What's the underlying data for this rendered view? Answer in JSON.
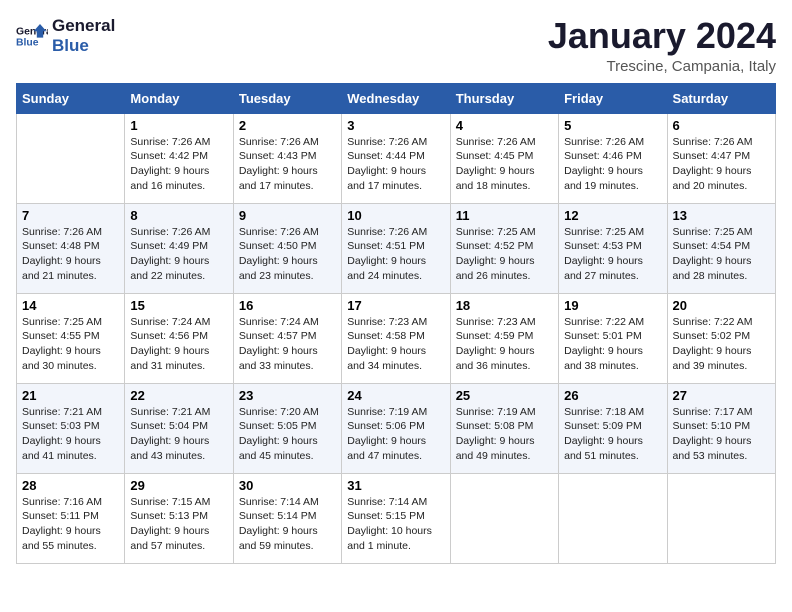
{
  "header": {
    "logo_text_general": "General",
    "logo_text_blue": "Blue",
    "month_title": "January 2024",
    "location": "Trescine, Campania, Italy"
  },
  "days_of_week": [
    "Sunday",
    "Monday",
    "Tuesday",
    "Wednesday",
    "Thursday",
    "Friday",
    "Saturday"
  ],
  "weeks": [
    [
      {
        "day": "",
        "info": ""
      },
      {
        "day": "1",
        "info": "Sunrise: 7:26 AM\nSunset: 4:42 PM\nDaylight: 9 hours\nand 16 minutes."
      },
      {
        "day": "2",
        "info": "Sunrise: 7:26 AM\nSunset: 4:43 PM\nDaylight: 9 hours\nand 17 minutes."
      },
      {
        "day": "3",
        "info": "Sunrise: 7:26 AM\nSunset: 4:44 PM\nDaylight: 9 hours\nand 17 minutes."
      },
      {
        "day": "4",
        "info": "Sunrise: 7:26 AM\nSunset: 4:45 PM\nDaylight: 9 hours\nand 18 minutes."
      },
      {
        "day": "5",
        "info": "Sunrise: 7:26 AM\nSunset: 4:46 PM\nDaylight: 9 hours\nand 19 minutes."
      },
      {
        "day": "6",
        "info": "Sunrise: 7:26 AM\nSunset: 4:47 PM\nDaylight: 9 hours\nand 20 minutes."
      }
    ],
    [
      {
        "day": "7",
        "info": "Sunrise: 7:26 AM\nSunset: 4:48 PM\nDaylight: 9 hours\nand 21 minutes."
      },
      {
        "day": "8",
        "info": "Sunrise: 7:26 AM\nSunset: 4:49 PM\nDaylight: 9 hours\nand 22 minutes."
      },
      {
        "day": "9",
        "info": "Sunrise: 7:26 AM\nSunset: 4:50 PM\nDaylight: 9 hours\nand 23 minutes."
      },
      {
        "day": "10",
        "info": "Sunrise: 7:26 AM\nSunset: 4:51 PM\nDaylight: 9 hours\nand 24 minutes."
      },
      {
        "day": "11",
        "info": "Sunrise: 7:25 AM\nSunset: 4:52 PM\nDaylight: 9 hours\nand 26 minutes."
      },
      {
        "day": "12",
        "info": "Sunrise: 7:25 AM\nSunset: 4:53 PM\nDaylight: 9 hours\nand 27 minutes."
      },
      {
        "day": "13",
        "info": "Sunrise: 7:25 AM\nSunset: 4:54 PM\nDaylight: 9 hours\nand 28 minutes."
      }
    ],
    [
      {
        "day": "14",
        "info": "Sunrise: 7:25 AM\nSunset: 4:55 PM\nDaylight: 9 hours\nand 30 minutes."
      },
      {
        "day": "15",
        "info": "Sunrise: 7:24 AM\nSunset: 4:56 PM\nDaylight: 9 hours\nand 31 minutes."
      },
      {
        "day": "16",
        "info": "Sunrise: 7:24 AM\nSunset: 4:57 PM\nDaylight: 9 hours\nand 33 minutes."
      },
      {
        "day": "17",
        "info": "Sunrise: 7:23 AM\nSunset: 4:58 PM\nDaylight: 9 hours\nand 34 minutes."
      },
      {
        "day": "18",
        "info": "Sunrise: 7:23 AM\nSunset: 4:59 PM\nDaylight: 9 hours\nand 36 minutes."
      },
      {
        "day": "19",
        "info": "Sunrise: 7:22 AM\nSunset: 5:01 PM\nDaylight: 9 hours\nand 38 minutes."
      },
      {
        "day": "20",
        "info": "Sunrise: 7:22 AM\nSunset: 5:02 PM\nDaylight: 9 hours\nand 39 minutes."
      }
    ],
    [
      {
        "day": "21",
        "info": "Sunrise: 7:21 AM\nSunset: 5:03 PM\nDaylight: 9 hours\nand 41 minutes."
      },
      {
        "day": "22",
        "info": "Sunrise: 7:21 AM\nSunset: 5:04 PM\nDaylight: 9 hours\nand 43 minutes."
      },
      {
        "day": "23",
        "info": "Sunrise: 7:20 AM\nSunset: 5:05 PM\nDaylight: 9 hours\nand 45 minutes."
      },
      {
        "day": "24",
        "info": "Sunrise: 7:19 AM\nSunset: 5:06 PM\nDaylight: 9 hours\nand 47 minutes."
      },
      {
        "day": "25",
        "info": "Sunrise: 7:19 AM\nSunset: 5:08 PM\nDaylight: 9 hours\nand 49 minutes."
      },
      {
        "day": "26",
        "info": "Sunrise: 7:18 AM\nSunset: 5:09 PM\nDaylight: 9 hours\nand 51 minutes."
      },
      {
        "day": "27",
        "info": "Sunrise: 7:17 AM\nSunset: 5:10 PM\nDaylight: 9 hours\nand 53 minutes."
      }
    ],
    [
      {
        "day": "28",
        "info": "Sunrise: 7:16 AM\nSunset: 5:11 PM\nDaylight: 9 hours\nand 55 minutes."
      },
      {
        "day": "29",
        "info": "Sunrise: 7:15 AM\nSunset: 5:13 PM\nDaylight: 9 hours\nand 57 minutes."
      },
      {
        "day": "30",
        "info": "Sunrise: 7:14 AM\nSunset: 5:14 PM\nDaylight: 9 hours\nand 59 minutes."
      },
      {
        "day": "31",
        "info": "Sunrise: 7:14 AM\nSunset: 5:15 PM\nDaylight: 10 hours\nand 1 minute."
      },
      {
        "day": "",
        "info": ""
      },
      {
        "day": "",
        "info": ""
      },
      {
        "day": "",
        "info": ""
      }
    ]
  ]
}
